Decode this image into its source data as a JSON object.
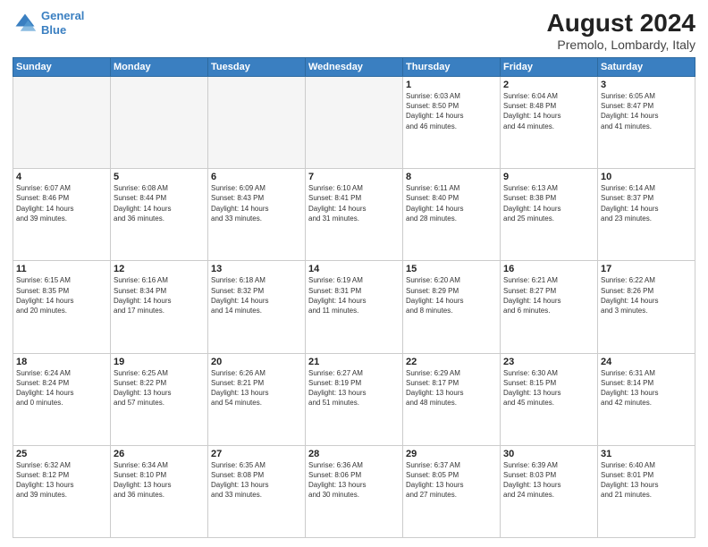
{
  "header": {
    "logo_line1": "General",
    "logo_line2": "Blue",
    "title": "August 2024",
    "subtitle": "Premolo, Lombardy, Italy"
  },
  "weekdays": [
    "Sunday",
    "Monday",
    "Tuesday",
    "Wednesday",
    "Thursday",
    "Friday",
    "Saturday"
  ],
  "weeks": [
    [
      {
        "day": "",
        "info": ""
      },
      {
        "day": "",
        "info": ""
      },
      {
        "day": "",
        "info": ""
      },
      {
        "day": "",
        "info": ""
      },
      {
        "day": "1",
        "info": "Sunrise: 6:03 AM\nSunset: 8:50 PM\nDaylight: 14 hours\nand 46 minutes."
      },
      {
        "day": "2",
        "info": "Sunrise: 6:04 AM\nSunset: 8:48 PM\nDaylight: 14 hours\nand 44 minutes."
      },
      {
        "day": "3",
        "info": "Sunrise: 6:05 AM\nSunset: 8:47 PM\nDaylight: 14 hours\nand 41 minutes."
      }
    ],
    [
      {
        "day": "4",
        "info": "Sunrise: 6:07 AM\nSunset: 8:46 PM\nDaylight: 14 hours\nand 39 minutes."
      },
      {
        "day": "5",
        "info": "Sunrise: 6:08 AM\nSunset: 8:44 PM\nDaylight: 14 hours\nand 36 minutes."
      },
      {
        "day": "6",
        "info": "Sunrise: 6:09 AM\nSunset: 8:43 PM\nDaylight: 14 hours\nand 33 minutes."
      },
      {
        "day": "7",
        "info": "Sunrise: 6:10 AM\nSunset: 8:41 PM\nDaylight: 14 hours\nand 31 minutes."
      },
      {
        "day": "8",
        "info": "Sunrise: 6:11 AM\nSunset: 8:40 PM\nDaylight: 14 hours\nand 28 minutes."
      },
      {
        "day": "9",
        "info": "Sunrise: 6:13 AM\nSunset: 8:38 PM\nDaylight: 14 hours\nand 25 minutes."
      },
      {
        "day": "10",
        "info": "Sunrise: 6:14 AM\nSunset: 8:37 PM\nDaylight: 14 hours\nand 23 minutes."
      }
    ],
    [
      {
        "day": "11",
        "info": "Sunrise: 6:15 AM\nSunset: 8:35 PM\nDaylight: 14 hours\nand 20 minutes."
      },
      {
        "day": "12",
        "info": "Sunrise: 6:16 AM\nSunset: 8:34 PM\nDaylight: 14 hours\nand 17 minutes."
      },
      {
        "day": "13",
        "info": "Sunrise: 6:18 AM\nSunset: 8:32 PM\nDaylight: 14 hours\nand 14 minutes."
      },
      {
        "day": "14",
        "info": "Sunrise: 6:19 AM\nSunset: 8:31 PM\nDaylight: 14 hours\nand 11 minutes."
      },
      {
        "day": "15",
        "info": "Sunrise: 6:20 AM\nSunset: 8:29 PM\nDaylight: 14 hours\nand 8 minutes."
      },
      {
        "day": "16",
        "info": "Sunrise: 6:21 AM\nSunset: 8:27 PM\nDaylight: 14 hours\nand 6 minutes."
      },
      {
        "day": "17",
        "info": "Sunrise: 6:22 AM\nSunset: 8:26 PM\nDaylight: 14 hours\nand 3 minutes."
      }
    ],
    [
      {
        "day": "18",
        "info": "Sunrise: 6:24 AM\nSunset: 8:24 PM\nDaylight: 14 hours\nand 0 minutes."
      },
      {
        "day": "19",
        "info": "Sunrise: 6:25 AM\nSunset: 8:22 PM\nDaylight: 13 hours\nand 57 minutes."
      },
      {
        "day": "20",
        "info": "Sunrise: 6:26 AM\nSunset: 8:21 PM\nDaylight: 13 hours\nand 54 minutes."
      },
      {
        "day": "21",
        "info": "Sunrise: 6:27 AM\nSunset: 8:19 PM\nDaylight: 13 hours\nand 51 minutes."
      },
      {
        "day": "22",
        "info": "Sunrise: 6:29 AM\nSunset: 8:17 PM\nDaylight: 13 hours\nand 48 minutes."
      },
      {
        "day": "23",
        "info": "Sunrise: 6:30 AM\nSunset: 8:15 PM\nDaylight: 13 hours\nand 45 minutes."
      },
      {
        "day": "24",
        "info": "Sunrise: 6:31 AM\nSunset: 8:14 PM\nDaylight: 13 hours\nand 42 minutes."
      }
    ],
    [
      {
        "day": "25",
        "info": "Sunrise: 6:32 AM\nSunset: 8:12 PM\nDaylight: 13 hours\nand 39 minutes."
      },
      {
        "day": "26",
        "info": "Sunrise: 6:34 AM\nSunset: 8:10 PM\nDaylight: 13 hours\nand 36 minutes."
      },
      {
        "day": "27",
        "info": "Sunrise: 6:35 AM\nSunset: 8:08 PM\nDaylight: 13 hours\nand 33 minutes."
      },
      {
        "day": "28",
        "info": "Sunrise: 6:36 AM\nSunset: 8:06 PM\nDaylight: 13 hours\nand 30 minutes."
      },
      {
        "day": "29",
        "info": "Sunrise: 6:37 AM\nSunset: 8:05 PM\nDaylight: 13 hours\nand 27 minutes."
      },
      {
        "day": "30",
        "info": "Sunrise: 6:39 AM\nSunset: 8:03 PM\nDaylight: 13 hours\nand 24 minutes."
      },
      {
        "day": "31",
        "info": "Sunrise: 6:40 AM\nSunset: 8:01 PM\nDaylight: 13 hours\nand 21 minutes."
      }
    ]
  ]
}
